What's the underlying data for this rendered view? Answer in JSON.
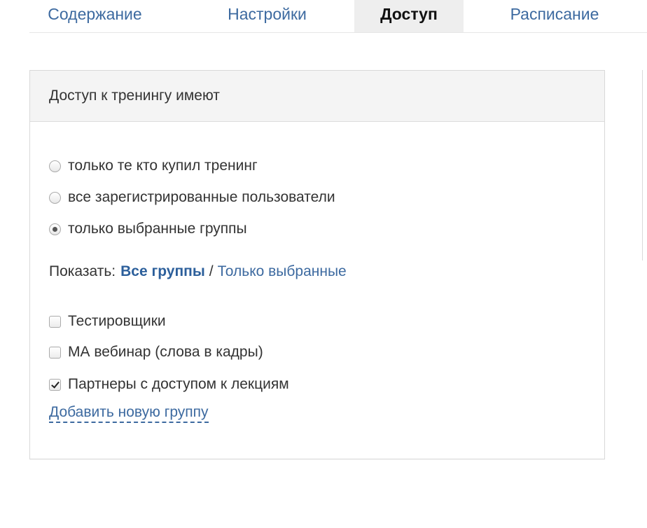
{
  "tabs": [
    {
      "label": "Содержание",
      "active": false
    },
    {
      "label": "Настройки",
      "active": false
    },
    {
      "label": "Доступ",
      "active": true
    },
    {
      "label": "Расписание",
      "active": false
    }
  ],
  "panel": {
    "title": "Доступ к тренингу имеют",
    "access_options": [
      {
        "label": "только те кто купил тренинг",
        "checked": false
      },
      {
        "label": "все зарегистрированные пользователи",
        "checked": false
      },
      {
        "label": "только выбранные группы",
        "checked": true
      }
    ],
    "filter": {
      "prefix": "Показать:",
      "all_groups": "Все группы",
      "separator": "/",
      "selected_only": "Только выбранные"
    },
    "groups": [
      {
        "label": "Тестировщики",
        "checked": false
      },
      {
        "label": "МА вебинар (слова в кадры)",
        "checked": false
      },
      {
        "label": "Партнеры с доступом к лекциям",
        "checked": true
      }
    ],
    "add_group_label": "Добавить новую группу"
  },
  "colors": {
    "link": "#3d6aa0",
    "active_tab_bg": "#eeeeee",
    "panel_header_bg": "#f4f4f4"
  }
}
